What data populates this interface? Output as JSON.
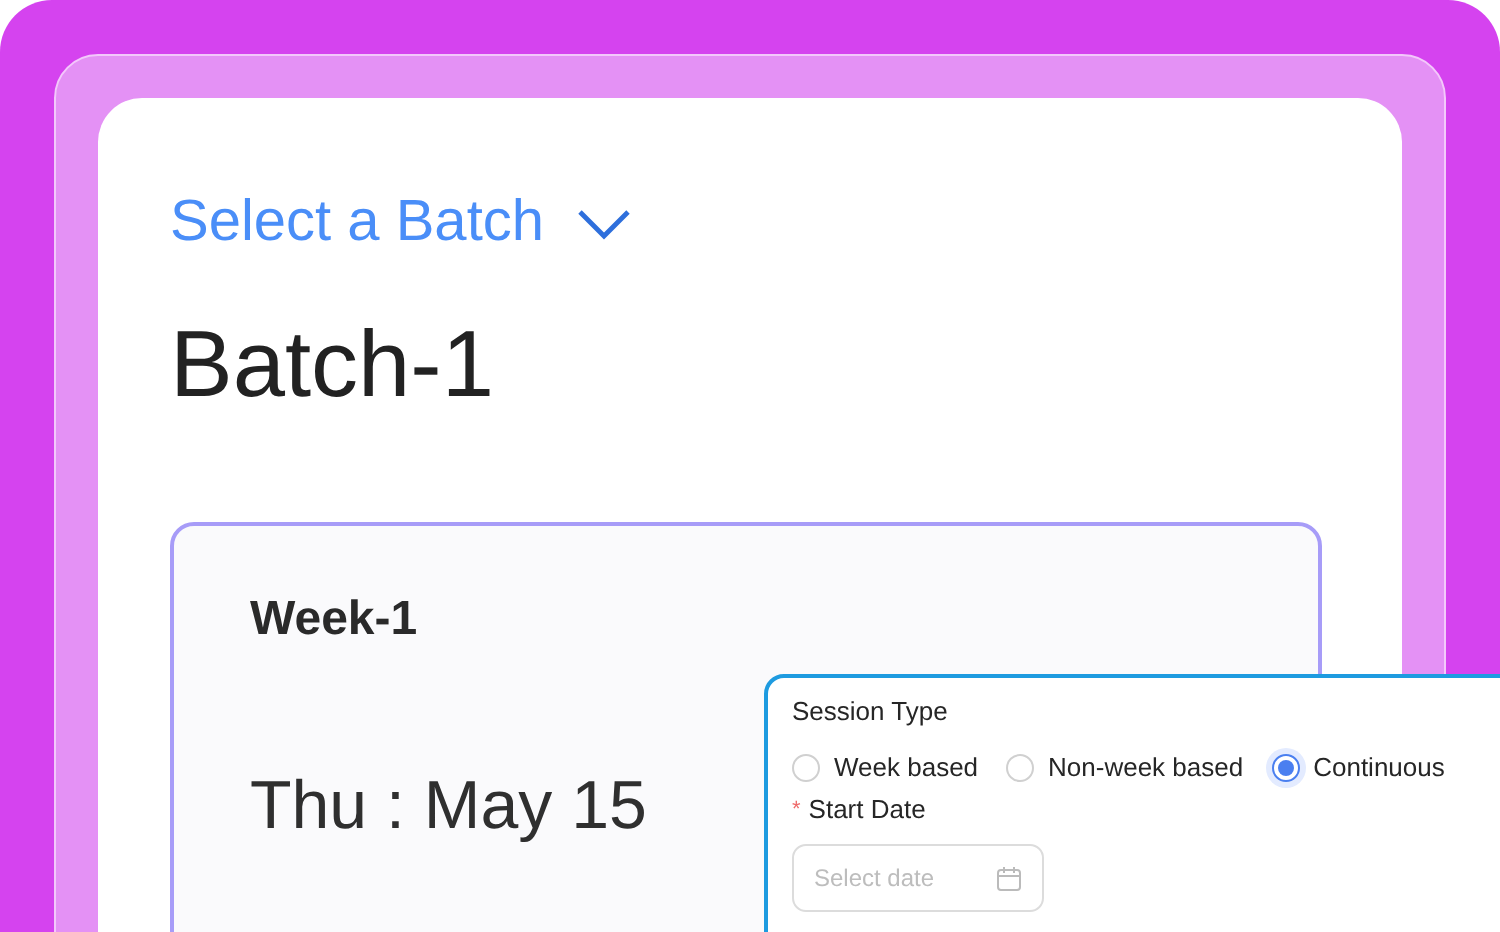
{
  "batch_selector": {
    "label": "Select a Batch"
  },
  "batch": {
    "title": "Batch-1"
  },
  "week_card": {
    "title": "Week-1",
    "date": "Thu : May 15"
  },
  "session_popup": {
    "title": "Session Type",
    "options": [
      {
        "label": "Week based",
        "selected": false
      },
      {
        "label": "Non-week based",
        "selected": false
      },
      {
        "label": "Continuous",
        "selected": true
      }
    ],
    "start_date": {
      "required_mark": "*",
      "label": "Start Date",
      "placeholder": "Select date"
    }
  }
}
